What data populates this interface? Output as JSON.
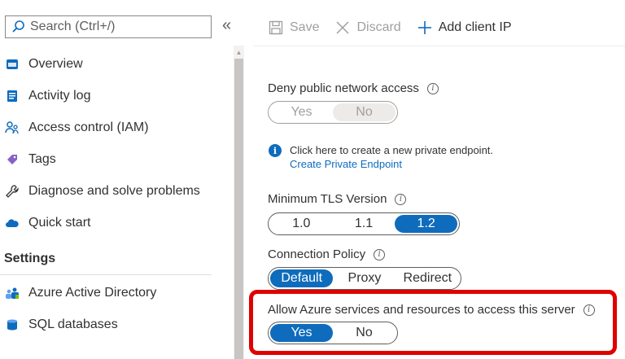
{
  "search": {
    "placeholder": "Search (Ctrl+/)"
  },
  "collapse_glyph": "«",
  "sidebar": {
    "items": [
      {
        "label": "Overview",
        "icon": "sql-database-icon"
      },
      {
        "label": "Activity log",
        "icon": "activity-log-icon"
      },
      {
        "label": "Access control (IAM)",
        "icon": "iam-people-icon"
      },
      {
        "label": "Tags",
        "icon": "tag-icon"
      },
      {
        "label": "Diagnose and solve problems",
        "icon": "wrench-icon"
      },
      {
        "label": "Quick start",
        "icon": "cloud-icon"
      }
    ],
    "section_header": "Settings",
    "settings_items": [
      {
        "label": "Azure Active Directory",
        "icon": "users-icon"
      },
      {
        "label": "SQL databases",
        "icon": "sql-database-icon"
      }
    ]
  },
  "toolbar": {
    "save_label": "Save",
    "discard_label": "Discard",
    "add_client_ip_label": "Add client IP"
  },
  "settings": {
    "deny_public": {
      "label": "Deny public network access",
      "options": [
        "Yes",
        "No"
      ],
      "selected": "No"
    },
    "info_text": "Click here to create a new private endpoint.",
    "info_link": "Create Private Endpoint",
    "tls": {
      "label": "Minimum TLS Version",
      "options": [
        "1.0",
        "1.1",
        "1.2"
      ],
      "selected": "1.2"
    },
    "connection_policy": {
      "label": "Connection Policy",
      "options": [
        "Default",
        "Proxy",
        "Redirect"
      ],
      "selected": "Default"
    },
    "allow_azure": {
      "label": "Allow Azure services and resources to access this server",
      "options": [
        "Yes",
        "No"
      ],
      "selected": "Yes"
    }
  },
  "colors": {
    "accent": "#0f6cbd",
    "highlight": "#e00000",
    "disabled": "#a19f9d"
  }
}
